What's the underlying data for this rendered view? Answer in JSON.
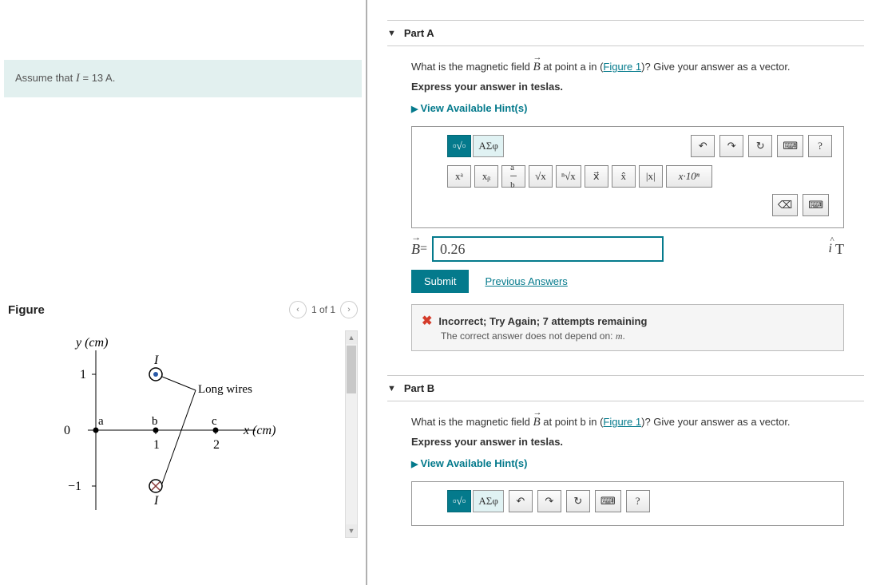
{
  "assume_text_prefix": "Assume that ",
  "assume_var": "I",
  "assume_text_suffix": " = 13 A.",
  "figure": {
    "title": "Figure",
    "pager": "1 of 1",
    "y_label": "y (cm)",
    "x_label": "x (cm)",
    "long_wires": "Long wires",
    "axis_y_top": "1",
    "axis_y_mid": "0",
    "axis_y_bot": "−1",
    "axis_x_1": "1",
    "axis_x_2": "2",
    "pt_a": "a",
    "pt_b": "b",
    "pt_c": "c",
    "I_top": "I",
    "I_bot": "I"
  },
  "partA": {
    "title": "Part A",
    "prompt_pre": "What is the magnetic field ",
    "vec": "B",
    "prompt_mid": " at point a in (",
    "fig_link": "Figure 1",
    "prompt_post": ")? Give your answer as a vector.",
    "instruction": "Express your answer in teslas.",
    "hints": "View Available Hint(s)",
    "greek": "ΑΣφ",
    "tb_xa": "xᵃ",
    "tb_xb": "xᵦ",
    "tb_frac": "a/b",
    "tb_sqrt": "√x",
    "tb_nsqrt": "ⁿ√x",
    "tb_vec": "x⃗",
    "tb_hat": "x̂",
    "tb_abs": "|x|",
    "tb_sci": "x·10ⁿ",
    "answer_var": "B",
    "answer_eq": " = ",
    "answer_value": "0.26",
    "unit_ihat": "i",
    "unit_T": "T",
    "submit": "Submit",
    "prev": "Previous Answers",
    "fb_title": "Incorrect; Try Again; 7 attempts remaining",
    "fb_sub_pre": "The correct answer does not depend on: ",
    "fb_sub_var": "m",
    "fb_sub_post": "."
  },
  "partB": {
    "title": "Part B",
    "prompt_pre": "What is the magnetic field ",
    "vec": "B",
    "prompt_mid": " at point b in (",
    "fig_link": "Figure 1",
    "prompt_post": ")? Give your answer as a vector.",
    "instruction": "Express your answer in teslas.",
    "hints": "View Available Hint(s)",
    "greek": "ΑΣφ"
  }
}
